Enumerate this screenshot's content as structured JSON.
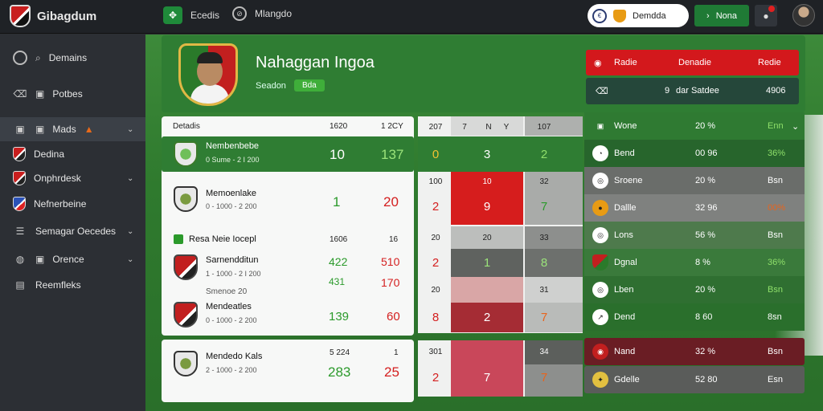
{
  "app": {
    "title": "Gibagdum"
  },
  "topbar": {
    "item1_label": "Ecedis",
    "item2_label": "Mlangdo",
    "pill_label": "Demdda",
    "green_btn_label": "Nona"
  },
  "sidebar": {
    "items": [
      {
        "label": "Demains",
        "icon": "search-icon"
      },
      {
        "label": "Potbes",
        "icon": "trash-icon"
      },
      {
        "label": "Mads",
        "icon": "image-icon"
      },
      {
        "label": "Dedina",
        "icon": "shield-icon"
      },
      {
        "label": "Onphrdesk",
        "icon": "shield-icon"
      },
      {
        "label": "Nefnerbeine",
        "icon": "shield-icon"
      },
      {
        "label": "Semagar Oecedes",
        "icon": "menu-icon"
      },
      {
        "label": "Orence",
        "icon": "image-icon"
      },
      {
        "label": "Reemfleks",
        "icon": "menu-icon"
      }
    ]
  },
  "hero": {
    "title": "Nahaggan Ingoa",
    "subtitle": "Seadon",
    "badge": "Bda",
    "stat_red": {
      "a": "Radie",
      "b": "Denadie",
      "c": "Redie"
    },
    "stat_dark": {
      "a": "9",
      "b": "dar Satdee",
      "c": "4906"
    }
  },
  "standings": {
    "header": {
      "title": "Detadis",
      "col1": "1620",
      "col2": "1 2CY"
    },
    "rows": [
      {
        "name": "Nembenbebe",
        "sub": "0 Sume - 2 I 200",
        "v1": "10",
        "v2": "137"
      },
      {
        "name": "Memoenlake",
        "sub": "0 - 1000 - 2 200",
        "v1": "1",
        "v2": "20"
      },
      {
        "name": "Resa Neie Iocepl",
        "sub": "",
        "v1": "1606",
        "v2": "16"
      },
      {
        "name": "Sarnendditun",
        "sub": "1 - 1000 - 2 I 200",
        "v1": "422",
        "v2": "510"
      },
      {
        "name": "Smenoe 20",
        "sub": "",
        "v1": "431",
        "v2": "170"
      },
      {
        "name": "Mendeatles",
        "sub": "0 - 1000 - 2 200",
        "v1": "139",
        "v2": "60"
      },
      {
        "name": "Mendedo Kals",
        "sub": "2 - 1000 - 2 200",
        "v1": "283",
        "v2": "25",
        "top1": "5 224",
        "top2": "1"
      }
    ]
  },
  "grid": {
    "header": {
      "c1": "207",
      "c2": "7",
      "c3": "N",
      "c4": "Y",
      "c5": "107"
    },
    "r1": {
      "a": "0",
      "b": "3",
      "c": "2"
    },
    "r2": {
      "a_top": "100",
      "b_top": "10",
      "c_top": "32",
      "a": "2",
      "b": "9",
      "c": "7"
    },
    "r3": {
      "a": "20",
      "b": "20",
      "c": "33"
    },
    "r4": {
      "a": "2",
      "b": "1",
      "c": "8"
    },
    "r5": {
      "a": "20",
      "c": "31"
    },
    "r6": {
      "a": "8",
      "b": "2",
      "c": "7"
    },
    "r7": {
      "a_top": "301",
      "c_top": "34",
      "a": "2",
      "b": "7",
      "c": "7"
    }
  },
  "right": {
    "rows": [
      {
        "name": "Wone",
        "pct": "20 %",
        "val": "Enn"
      },
      {
        "name": "Bend",
        "pct": "00 96",
        "val": "36%"
      },
      {
        "name": "Sroene",
        "pct": "20 %",
        "val": "Bsn"
      },
      {
        "name": "Dallle",
        "pct": "32 96",
        "val": "00%"
      },
      {
        "name": "Lons",
        "pct": "56 %",
        "val": "Bsn"
      },
      {
        "name": "Dgnal",
        "pct": "8 %",
        "val": "36%"
      },
      {
        "name": "Lben",
        "pct": "20 %",
        "val": "Bsn"
      },
      {
        "name": "Dend",
        "pct": "8 60",
        "val": "8sn"
      },
      {
        "name": "Nand",
        "pct": "32 %",
        "val": "Bsn"
      },
      {
        "name": "Gdelle",
        "pct": "52 80",
        "val": "Esn"
      }
    ]
  }
}
